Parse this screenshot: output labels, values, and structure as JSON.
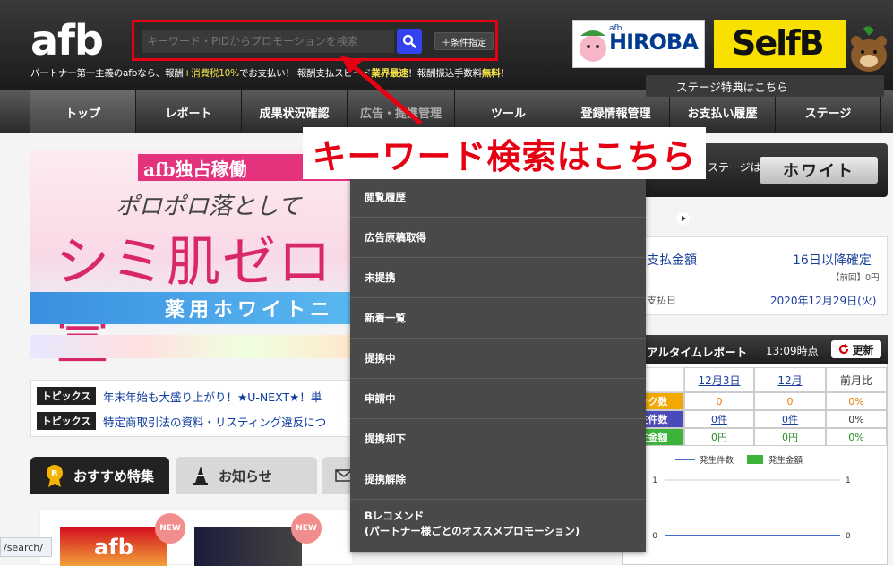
{
  "header": {
    "logo": "afb",
    "tagline_parts": [
      "パートナー第一主義のafbなら、報酬",
      "+消費税10%",
      "でお支払い！ 報酬支払スピード",
      "業界最速",
      "！報酬振込手数料",
      "無料",
      "！"
    ],
    "search": {
      "placeholder": "キーワード・PIDからプロモーションを検索",
      "cond_label": "＋条件指定"
    },
    "banner_hiroba": {
      "small": "afb",
      "text": "HIROBA"
    },
    "banner_selfb": {
      "text": "SelfB"
    }
  },
  "nav": {
    "items": [
      "トップ",
      "レポート",
      "成果状況確認",
      "広告・提携管理",
      "ツール",
      "登録情報管理",
      "お支払い履歴",
      "ステージ"
    ]
  },
  "promo": {
    "top": "afb独占稼働",
    "mid": "ポロポロ落として",
    "big": "シミ肌ゼロ宣",
    "bottom": "薬用ホワイトニ"
  },
  "topics": {
    "badge": "トピックス",
    "items": [
      "年末年始も大盛り上がり！★U-NEXT★！単",
      "特定商取引法の資料・リスティング違反につ"
    ]
  },
  "tabs": {
    "feature": "おすすめ特集",
    "news": "お知らせ"
  },
  "feature": {
    "new_label": "NEW",
    "thumb1": "afb"
  },
  "dropdown": {
    "items": [
      "閲覧履歴",
      "広告原稿取得",
      "未提携",
      "新着一覧",
      "提携中",
      "申請中",
      "提携却下",
      "提携解除"
    ],
    "last_line1": "Bレコメンド",
    "last_line2": "(パートナー様ごとのオススメプロモーション)"
  },
  "callout": "キーワード検索はこちら",
  "stage": {
    "label": "ステージは",
    "value": "ホワイト",
    "benefit": "ステージ特典はこちら"
  },
  "payment": {
    "amount_label": "支払金額",
    "amount_value": "16日以降確定",
    "prev": "【前回】0円",
    "date_label": "支払日",
    "date_value": "2020年12月29日(火)"
  },
  "realtime": {
    "title": "アルタイムレポート",
    "time": "13:09時点",
    "refresh": "更新",
    "col_dec3": "12月3日",
    "col_dec": "12月",
    "col_prev": "前月比",
    "rows": [
      {
        "label": "ック数",
        "v1": "0",
        "v2": "0",
        "v3": "0%"
      },
      {
        "label": "生件数",
        "v1": "0件",
        "v2": "0件",
        "v3": "0%"
      },
      {
        "label": "生金額",
        "v1": "0円",
        "v2": "0円",
        "v3": "0%"
      }
    ],
    "legend_count": "発生件数",
    "legend_amount": "発生金額"
  },
  "chart_data": {
    "type": "line",
    "categories": [],
    "series": [
      {
        "name": "発生件数",
        "values": [
          0
        ]
      },
      {
        "name": "発生金額",
        "values": [
          0
        ]
      }
    ],
    "ylim": [
      0,
      1
    ],
    "yticks": [
      "1",
      "0"
    ],
    "yticks_right": [
      "1",
      "0"
    ]
  },
  "status_url": "/search/",
  "colors": {
    "accent_red": "#e60012",
    "search_blue": "#3344ee",
    "link_blue": "#1a3f9b"
  }
}
